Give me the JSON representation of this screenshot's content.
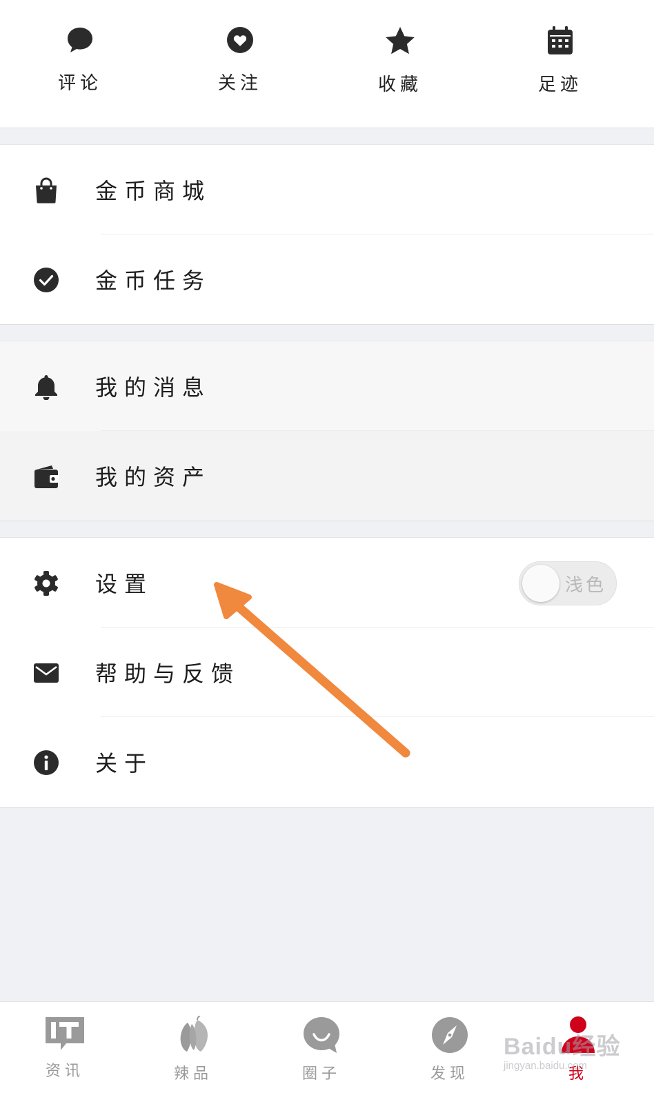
{
  "quick_actions": [
    {
      "label": "评论",
      "icon": "comment-icon"
    },
    {
      "label": "关注",
      "icon": "heart-icon"
    },
    {
      "label": "收藏",
      "icon": "star-icon"
    },
    {
      "label": "足迹",
      "icon": "calendar-icon"
    }
  ],
  "section_coins": {
    "items": [
      {
        "label": "金币商城",
        "icon": "shopping-bag-icon"
      },
      {
        "label": "金币任务",
        "icon": "check-circle-icon"
      }
    ]
  },
  "section_personal": {
    "items": [
      {
        "label": "我的消息",
        "icon": "bell-icon"
      },
      {
        "label": "我的资产",
        "icon": "wallet-icon"
      }
    ]
  },
  "section_settings": {
    "items": [
      {
        "label": "设置",
        "icon": "gear-icon"
      },
      {
        "label": "帮助与反馈",
        "icon": "mail-icon"
      },
      {
        "label": "关于",
        "icon": "info-icon"
      }
    ],
    "theme_toggle_label": "浅色"
  },
  "tabbar": {
    "tabs": [
      {
        "label": "资讯",
        "icon": "it-news-icon"
      },
      {
        "label": "辣品",
        "icon": "pepper-icon"
      },
      {
        "label": "圈子",
        "icon": "chat-smile-icon"
      },
      {
        "label": "发现",
        "icon": "compass-icon"
      },
      {
        "label": "我",
        "icon": "user-icon"
      }
    ],
    "active_index": 4
  },
  "annotation": {
    "arrow_color": "#f0883e"
  },
  "watermark": {
    "brand": "Baidu经验",
    "site": "jingyan.baidu.com"
  },
  "colors": {
    "accent": "#d0021b",
    "icon": "#2b2b2b",
    "inactive": "#9a9a9a"
  }
}
